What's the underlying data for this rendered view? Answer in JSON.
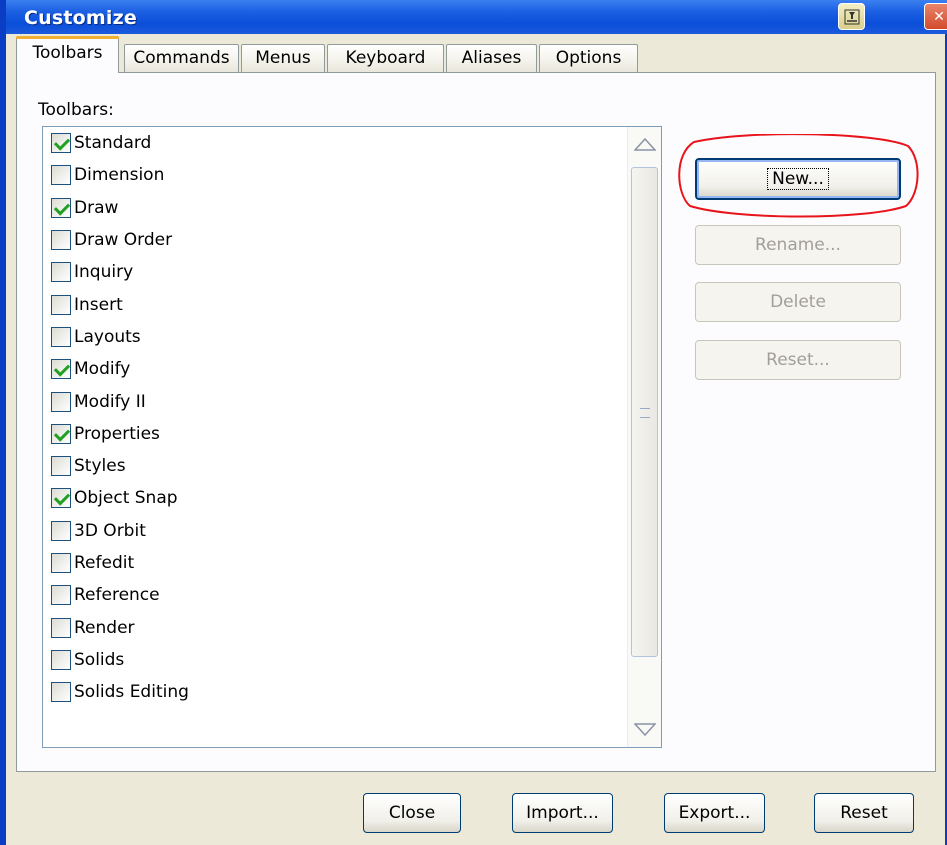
{
  "window": {
    "title": "Customize",
    "help_icon": "pin-icon",
    "close_icon": "close-icon"
  },
  "tabs": [
    {
      "label": "Toolbars",
      "active": true
    },
    {
      "label": "Commands",
      "active": false
    },
    {
      "label": "Menus",
      "active": false
    },
    {
      "label": "Keyboard",
      "active": false
    },
    {
      "label": "Aliases",
      "active": false
    },
    {
      "label": "Options",
      "active": false
    }
  ],
  "toolbars": {
    "label": "Toolbars:",
    "items": [
      {
        "label": "Standard",
        "checked": true
      },
      {
        "label": "Dimension",
        "checked": false
      },
      {
        "label": "Draw",
        "checked": true
      },
      {
        "label": "Draw Order",
        "checked": false
      },
      {
        "label": "Inquiry",
        "checked": false
      },
      {
        "label": "Insert",
        "checked": false
      },
      {
        "label": "Layouts",
        "checked": false
      },
      {
        "label": "Modify",
        "checked": true
      },
      {
        "label": "Modify II",
        "checked": false
      },
      {
        "label": "Properties",
        "checked": true
      },
      {
        "label": "Styles",
        "checked": false
      },
      {
        "label": "Object Snap",
        "checked": true
      },
      {
        "label": "3D Orbit",
        "checked": false
      },
      {
        "label": "Refedit",
        "checked": false
      },
      {
        "label": "Reference",
        "checked": false
      },
      {
        "label": "Render",
        "checked": false
      },
      {
        "label": "Solids",
        "checked": false
      },
      {
        "label": "Solids Editing",
        "checked": false
      }
    ]
  },
  "side_buttons": {
    "new": "New...",
    "rename": "Rename...",
    "delete": "Delete",
    "reset": "Reset..."
  },
  "footer_buttons": {
    "close": "Close",
    "import": "Import...",
    "export": "Export...",
    "reset": "Reset"
  },
  "colors": {
    "titlebar": "#0a4fd9",
    "annotation": "#e8141c",
    "checkmark": "#21a121"
  }
}
